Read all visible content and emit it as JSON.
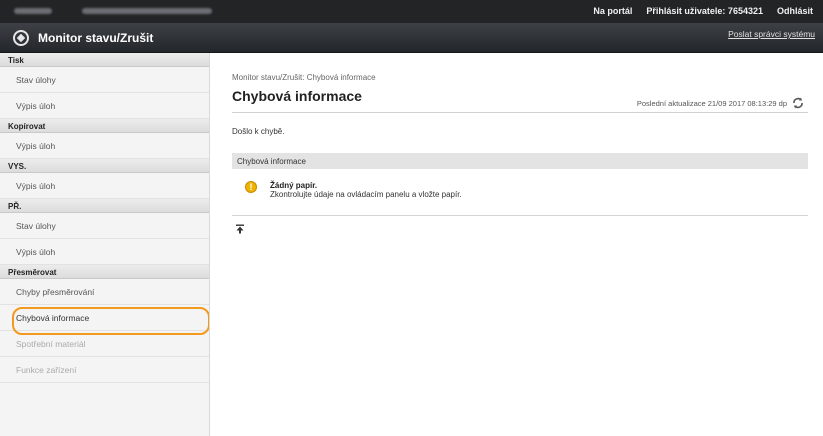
{
  "topbar": {
    "portal_link": "Na portál",
    "logged_user": "Přihlásit uživatele: 7654321",
    "logout": "Odhlásit"
  },
  "titlebar": {
    "title": "Monitor stavu/Zrušit",
    "admin_link": "Poslat správci systému"
  },
  "sidebar": {
    "tisk": {
      "header": "Tisk",
      "items": [
        "Stav úlohy",
        "Výpis úloh"
      ]
    },
    "kopirovat": {
      "header": "Kopírovat",
      "items": [
        "Výpis úloh"
      ]
    },
    "vys": {
      "header": "VYS.",
      "items": [
        "Výpis úloh"
      ]
    },
    "pr": {
      "header": "PŘ.",
      "items": [
        "Stav úlohy",
        "Výpis úloh"
      ]
    },
    "presmerovat": {
      "header": "Přesměrovat",
      "items": [
        "Chyby přesměrování",
        "Chybová informace",
        "Spotřební materiál",
        "Funkce zařízení"
      ]
    }
  },
  "main": {
    "breadcrumb": "Monitor stavu/Zrušit: Chybová informace",
    "heading": "Chybová informace",
    "last_update": "Poslední aktualizace 21/09 2017 08:13:29 dp",
    "status": "Došlo k chybě.",
    "section_title": "Chybová informace",
    "error_title": "Žádný papír.",
    "error_desc": "Zkontrolujte údaje na ovládacím panelu a vložte papír."
  },
  "colors": {
    "highlight": "#f39a1e",
    "warning": "#f0b400",
    "topbar": "#222426"
  },
  "icons": {
    "logo": "canon-logo-icon",
    "refresh": "refresh-icon",
    "warning": "warning-icon",
    "to_top": "back-to-top-icon"
  }
}
